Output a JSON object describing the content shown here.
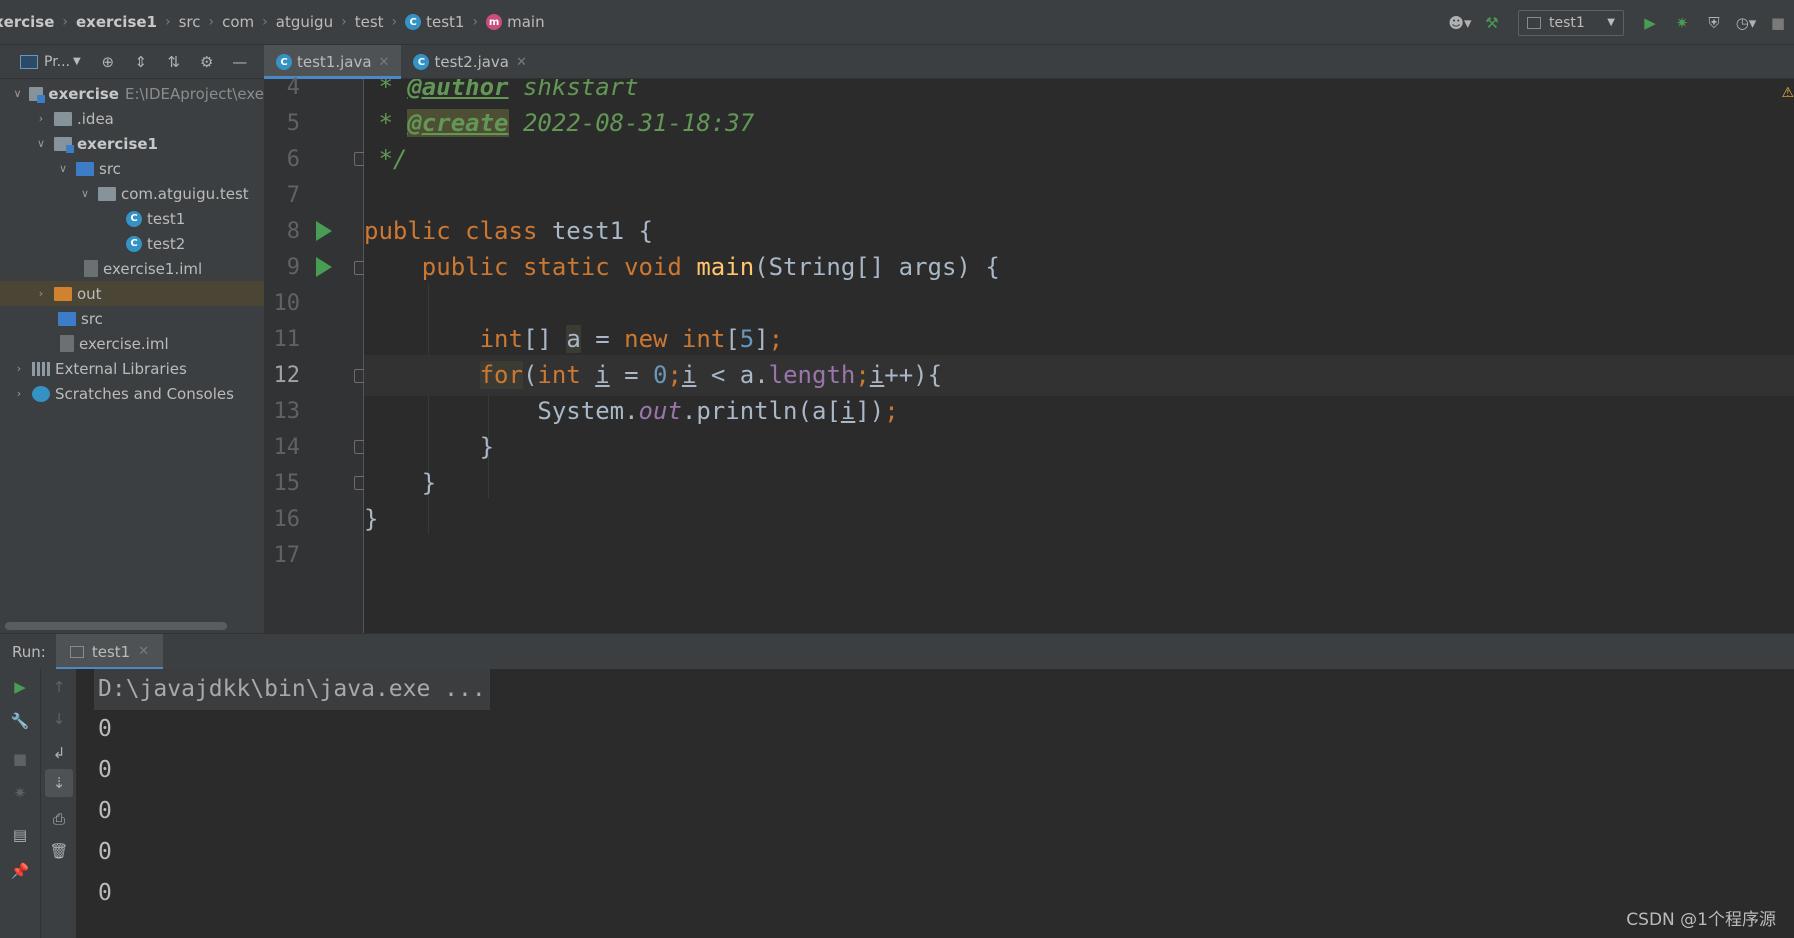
{
  "breadcrumb": [
    {
      "label": "xercise",
      "bold": true
    },
    {
      "label": "exercise1",
      "bold": true
    },
    {
      "label": "src"
    },
    {
      "label": "com"
    },
    {
      "label": "atguigu"
    },
    {
      "label": "test"
    },
    {
      "label": "test1",
      "icon": "class-icon"
    },
    {
      "label": "main",
      "icon": "method-icon"
    }
  ],
  "toolbar": {
    "run_config": "test1",
    "icons": [
      "user-icon",
      "build-hammer-icon",
      "run-icon",
      "debug-icon",
      "coverage-icon",
      "profile-icon",
      "stop-icon"
    ]
  },
  "project": {
    "title": "Pr...",
    "tree": [
      {
        "label": "exercise",
        "path": "E:\\IDEAproject\\exe",
        "level": 0,
        "expanded": true,
        "type": "module",
        "bold": true
      },
      {
        "label": ".idea",
        "level": 1,
        "expanded": false,
        "type": "folder"
      },
      {
        "label": "exercise1",
        "level": 1,
        "expanded": true,
        "type": "module",
        "bold": true
      },
      {
        "label": "src",
        "level": 2,
        "expanded": true,
        "type": "source"
      },
      {
        "label": "com.atguigu.test",
        "level": 3,
        "expanded": true,
        "type": "package"
      },
      {
        "label": "test1",
        "level": 4,
        "type": "class"
      },
      {
        "label": "test2",
        "level": 4,
        "type": "class"
      },
      {
        "label": "exercise1.iml",
        "level": 2,
        "type": "file"
      },
      {
        "label": "out",
        "level": 1,
        "expanded": false,
        "type": "out",
        "selected": true
      },
      {
        "label": "src",
        "level": 1,
        "type": "source"
      },
      {
        "label": "exercise.iml",
        "level": 1,
        "type": "file"
      },
      {
        "label": "External Libraries",
        "level": 0,
        "expanded": false,
        "type": "libs"
      },
      {
        "label": "Scratches and Consoles",
        "level": 0,
        "expanded": false,
        "type": "scratch"
      }
    ]
  },
  "tabs": [
    {
      "label": "test1.java",
      "active": true
    },
    {
      "label": "test2.java",
      "active": false
    }
  ],
  "editor": {
    "current_line": 12,
    "lines": [
      {
        "n": "4"
      },
      {
        "n": "5"
      },
      {
        "n": "6"
      },
      {
        "n": "7"
      },
      {
        "n": "8"
      },
      {
        "n": "9"
      },
      {
        "n": "10"
      },
      {
        "n": "11"
      },
      {
        "n": "12"
      },
      {
        "n": "13"
      },
      {
        "n": "14"
      },
      {
        "n": "15"
      },
      {
        "n": "16"
      },
      {
        "n": "17"
      }
    ],
    "code": {
      "l4_star": " * ",
      "l4_tag": "@author",
      "l4_text": " shkstart",
      "l5_star": " * ",
      "l5_tag": "@create",
      "l5_text": " 2022-08-31-18:37",
      "l6": " */",
      "l8_kw": "public class",
      "l8_rest": " test1 {",
      "l9_indent": "    ",
      "l9_kw": "public static void",
      "l9_sp": " ",
      "l9_fn": "main",
      "l9_rest": "(String[] args) {",
      "l11_indent": "        ",
      "l11_kw1": "int",
      "l11_a": "[] ",
      "l11_var": "a",
      "l11_b": " = ",
      "l11_kw2": "new int",
      "l11_c": "[",
      "l11_num": "5",
      "l11_d": "]",
      "l11_semi": ";",
      "l12_indent": "        ",
      "l12_for": "for",
      "l12_a": "(",
      "l12_int": "int",
      "l12_sp": " ",
      "l12_i1": "i",
      "l12_b": " = ",
      "l12_zero": "0",
      "l12_semi1": ";",
      "l12_i2": "i",
      "l12_c": " < a.",
      "l12_len": "length",
      "l12_semi2": ";",
      "l12_i3": "i",
      "l12_d": "++){",
      "l13_indent": "            ",
      "l13_a": "System.",
      "l13_out": "out",
      "l13_b": ".println(a[",
      "l13_i": "i",
      "l13_c": "])",
      "l13_semi": ";",
      "l14": "        }",
      "l15": "    }",
      "l16": "}"
    }
  },
  "run": {
    "label": "Run:",
    "tab": "test1",
    "command": "D:\\javajdkk\\bin\\java.exe ...",
    "output": [
      "0",
      "0",
      "0",
      "0",
      "0"
    ]
  },
  "watermark": "CSDN @1个程序源"
}
